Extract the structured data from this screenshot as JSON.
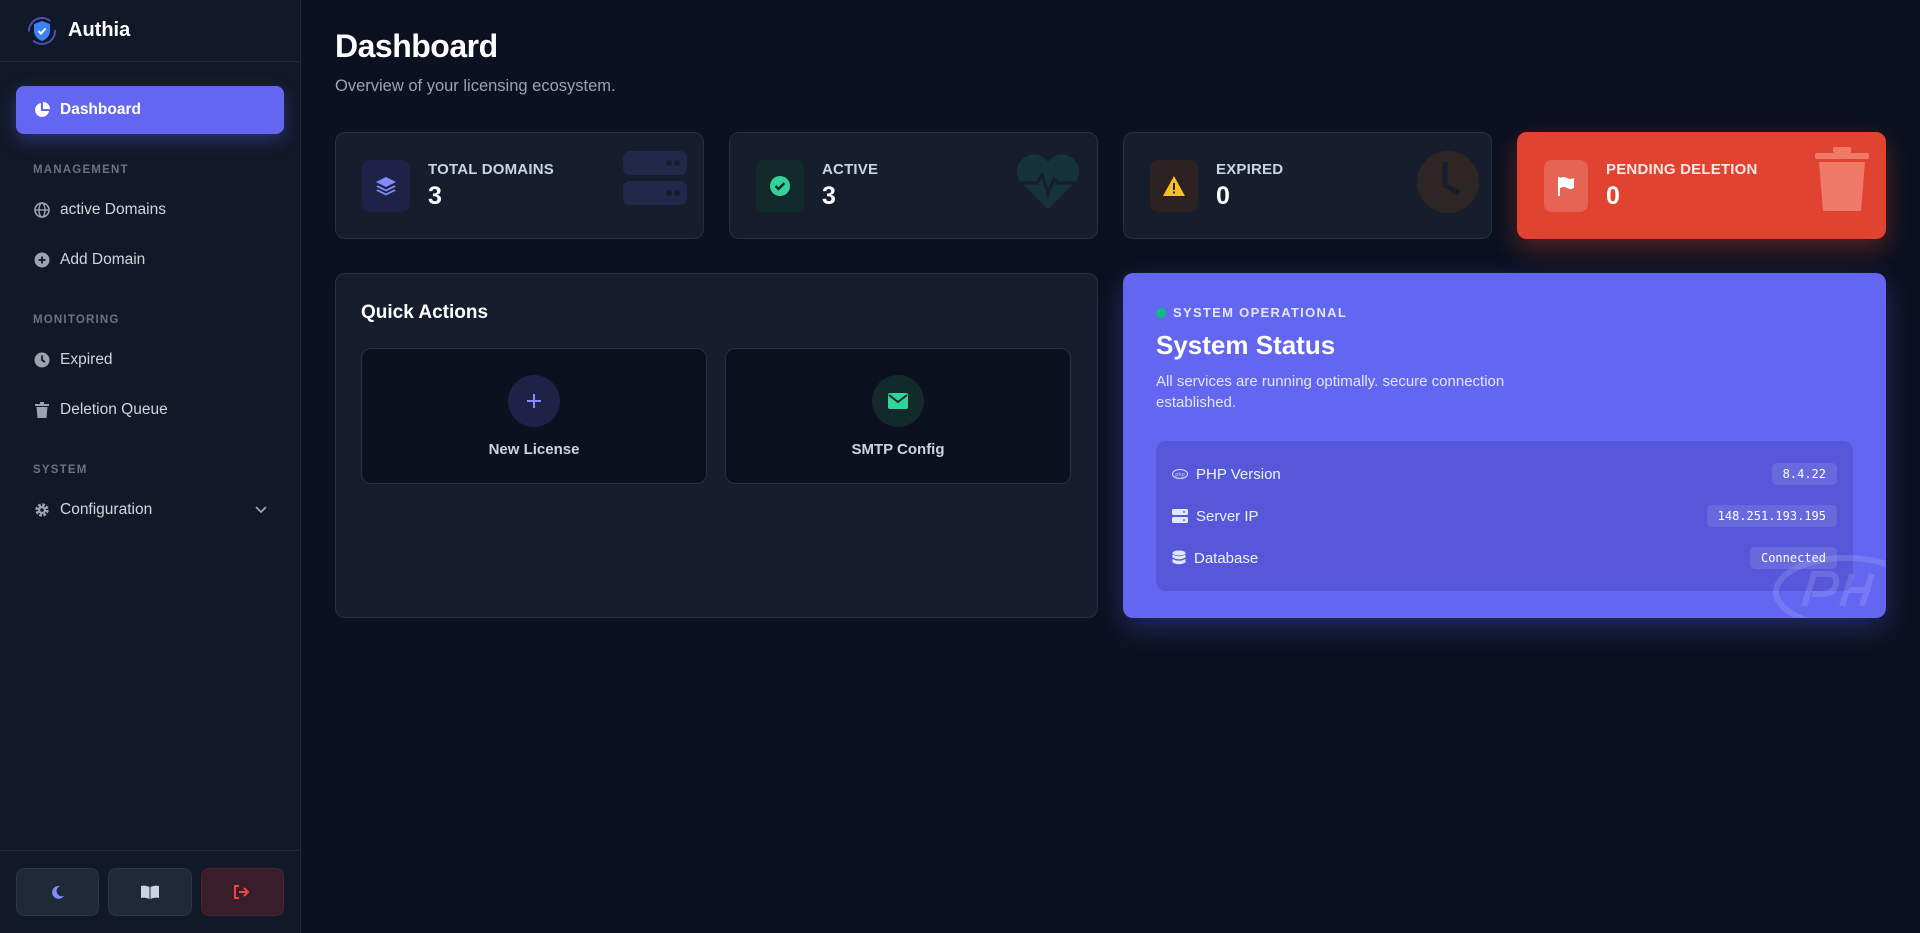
{
  "brand": {
    "name": "Authia"
  },
  "sidebar": {
    "dashboard": "Dashboard",
    "sections": {
      "management": "MANAGEMENT",
      "monitoring": "MONITORING",
      "system": "SYSTEM"
    },
    "items": {
      "active_domains": "active Domains",
      "add_domain": "Add Domain",
      "expired": "Expired",
      "deletion_queue": "Deletion Queue",
      "configuration": "Configuration"
    }
  },
  "header": {
    "title": "Dashboard",
    "subtitle": "Overview of your licensing ecosystem."
  },
  "stats": [
    {
      "label": "TOTAL DOMAINS",
      "value": "3",
      "icon": "layers-icon",
      "color": "#818cf8"
    },
    {
      "label": "ACTIVE",
      "value": "3",
      "icon": "check-circle-icon",
      "color": "#34d399"
    },
    {
      "label": "EXPIRED",
      "value": "0",
      "icon": "warning-icon",
      "color": "#fbbf24"
    },
    {
      "label": "PENDING DELETION",
      "value": "0",
      "icon": "flag-icon",
      "color": "#e0432f"
    }
  ],
  "quick_actions": {
    "title": "Quick Actions",
    "new_license": "New License",
    "smtp_config": "SMTP Config"
  },
  "system_status": {
    "operational": "SYSTEM OPERATIONAL",
    "title": "System Status",
    "description": "All services are running optimally. secure connection established.",
    "rows": [
      {
        "label": "PHP Version",
        "value": "8.4.22"
      },
      {
        "label": "Server IP",
        "value": "148.251.193.195"
      },
      {
        "label": "Database",
        "value": "Connected"
      }
    ]
  },
  "colors": {
    "accent": "#6366f1",
    "danger": "#e0432f",
    "success": "#10b981",
    "background": "#0b1120"
  }
}
